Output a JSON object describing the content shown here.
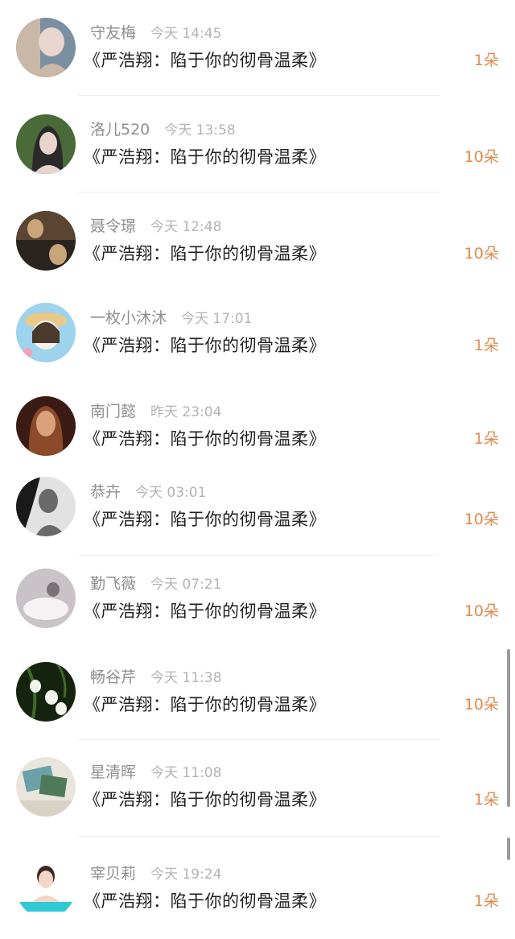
{
  "items": [
    {
      "name": "守友梅",
      "time": "今天 14:45",
      "title": "《严浩翔：陷于你的彻骨温柔》",
      "gift": "1朵",
      "avatar_colors": [
        "#c9b7a8",
        "#7a8fa0",
        "#e8d6cf"
      ]
    },
    {
      "name": "洛儿520",
      "time": "今天 13:58",
      "title": "《严浩翔：陷于你的彻骨温柔》",
      "gift": "10朵",
      "avatar_colors": [
        "#4a6a3a",
        "#2b2a2a",
        "#e7d4cd"
      ]
    },
    {
      "name": "聂令璟",
      "time": "今天 12:48",
      "title": "《严浩翔：陷于你的彻骨温柔》",
      "gift": "10朵",
      "avatar_colors": [
        "#5b4432",
        "#c9a57a",
        "#2a2420"
      ]
    },
    {
      "name": "一枚小沐沐",
      "time": "今天 17:01",
      "title": "《严浩翔：陷于你的彻骨温柔》",
      "gift": "1朵",
      "avatar_colors": [
        "#9ed3ec",
        "#f4f1ea",
        "#4a3a2c"
      ]
    },
    {
      "name": "南门懿",
      "time": "昨天 23:04",
      "title": "《严浩翔：陷于你的彻骨温柔》",
      "gift": "1朵",
      "avatar_colors": [
        "#3a1c14",
        "#8c4a2a",
        "#d9a27a"
      ]
    },
    {
      "name": "恭卉",
      "time": "今天 03:01",
      "title": "《严浩翔：陷于你的彻骨温柔》",
      "gift": "10朵",
      "avatar_colors": [
        "#1a1a1a",
        "#e2e2e2",
        "#6a6a6a"
      ]
    },
    {
      "name": "勤飞薇",
      "time": "今天 07:21",
      "title": "《严浩翔：陷于你的彻骨温柔》",
      "gift": "10朵",
      "avatar_colors": [
        "#c9c3c8",
        "#f6f1f3",
        "#7a7277"
      ]
    },
    {
      "name": "畅谷芹",
      "time": "今天 11:38",
      "title": "《严浩翔：陷于你的彻骨温柔》",
      "gift": "10朵",
      "avatar_colors": [
        "#16240f",
        "#3e6a28",
        "#f4f4ee"
      ]
    },
    {
      "name": "星清晖",
      "time": "今天 11:08",
      "title": "《严浩翔：陷于你的彻骨温柔》",
      "gift": "1朵",
      "avatar_colors": [
        "#e9e4dc",
        "#6aa0a8",
        "#4e7a5a"
      ]
    },
    {
      "name": "宰贝莉",
      "time": "今天 19:24",
      "title": "《严浩翔：陷于你的彻骨温柔》",
      "gift": "1朵",
      "avatar_colors": [
        "#2fc9d6",
        "#f3d6c6",
        "#ffffff"
      ]
    }
  ]
}
